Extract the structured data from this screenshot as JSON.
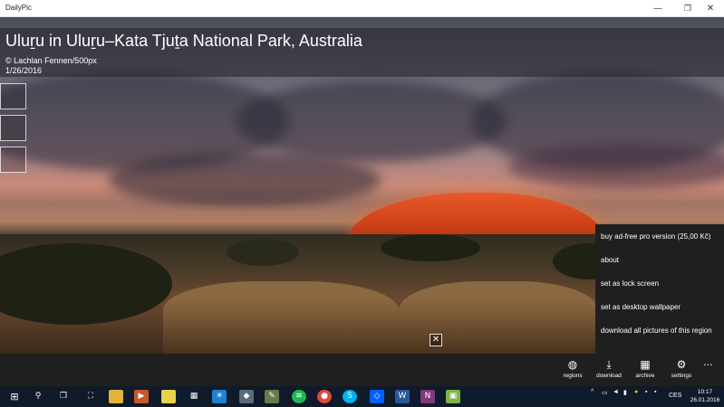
{
  "window": {
    "title": "DailyPic",
    "minimize": "—",
    "maximize": "❐",
    "close": "✕"
  },
  "caption": {
    "title": "Uluṟu in Uluṟu–Kata Tjuṯa National Park, Australia",
    "credit": "© Lachlan Fennen/500px",
    "date": "1/26/2016"
  },
  "menu": {
    "items": [
      "buy ad-free pro version (25,00 Kč)",
      "about",
      "set as lock screen",
      "set as desktop wallpaper",
      "download all pictures of this region"
    ]
  },
  "appbar": {
    "buttons": [
      {
        "label": "regions",
        "icon": "globe-icon",
        "glyph": "◍"
      },
      {
        "label": "download",
        "icon": "download-icon",
        "glyph": "⤓"
      },
      {
        "label": "archive",
        "icon": "calendar-icon",
        "glyph": "▦"
      },
      {
        "label": "settings",
        "icon": "gear-icon",
        "glyph": "⚙"
      }
    ],
    "more": "···"
  },
  "taskbar": {
    "language": "CES",
    "time": "10:17",
    "date": "26.01.2016"
  },
  "colors": {
    "menu_bg": "#1f1f1f",
    "appbar_bg": "#1f1f1f",
    "taskbar_bg": "#0f1a2a"
  }
}
